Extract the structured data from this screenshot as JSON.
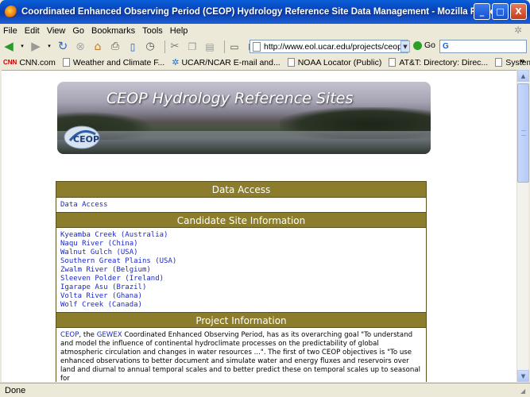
{
  "window": {
    "title": "Coordinated Enhanced Observing Period (CEOP) Hydrology Reference Site Data Management - Mozilla Firefox",
    "minimize": "_",
    "maximize": "□",
    "close": "X"
  },
  "menu": {
    "items": [
      "File",
      "Edit",
      "View",
      "Go",
      "Bookmarks",
      "Tools",
      "Help"
    ]
  },
  "toolbar": {
    "url": "http://www.eol.ucar.edu/projects/ceop/d",
    "go_label": "Go",
    "search_value": ""
  },
  "bookmarks": {
    "items": [
      "CNN.com",
      "Weather and Climate F...",
      "UCAR/NCAR E-mail and...",
      "NOAA Locator (Public)",
      "AT&T: Directory: Direc...",
      "Systems Support Online"
    ],
    "cnn_badge": "CNN",
    "more": "»"
  },
  "banner": {
    "title": "CEOP Hydrology Reference Sites"
  },
  "sections": {
    "data_access": {
      "heading": "Data Access",
      "links": [
        "Data Access"
      ]
    },
    "candidate_sites": {
      "heading": "Candidate Site Information",
      "links": [
        "Kyeamba Creek (Australia)",
        "Naqu River (China)",
        "Walnut Gulch (USA)",
        "Southern Great Plains (USA)",
        "Zwalm River (Belgium)",
        "Sleeven Polder (Ireland)",
        "Igarape Asu (Brazil)",
        "Volta River (Ghana)",
        "Wolf Creek (Canada)"
      ]
    },
    "project_info": {
      "heading": "Project Information",
      "link_ceop": "CEOP",
      "text_1": ", the ",
      "link_gewex": "GEWEX",
      "text_2": " Coordinated Enhanced Observing Period, has as its overarching goal \"To understand and model the influence of continental hydroclimate processes on the predictability of global atmospheric circulation and changes in water resources ...\". The first of two CEOP objectives is \"To use enhanced observations to better document and simulate water and energy fluxes and reservoirs over land and diurnal to annual temporal scales and to better predict these on temporal scales up to seasonal for"
    }
  },
  "status": {
    "text": "Done"
  }
}
